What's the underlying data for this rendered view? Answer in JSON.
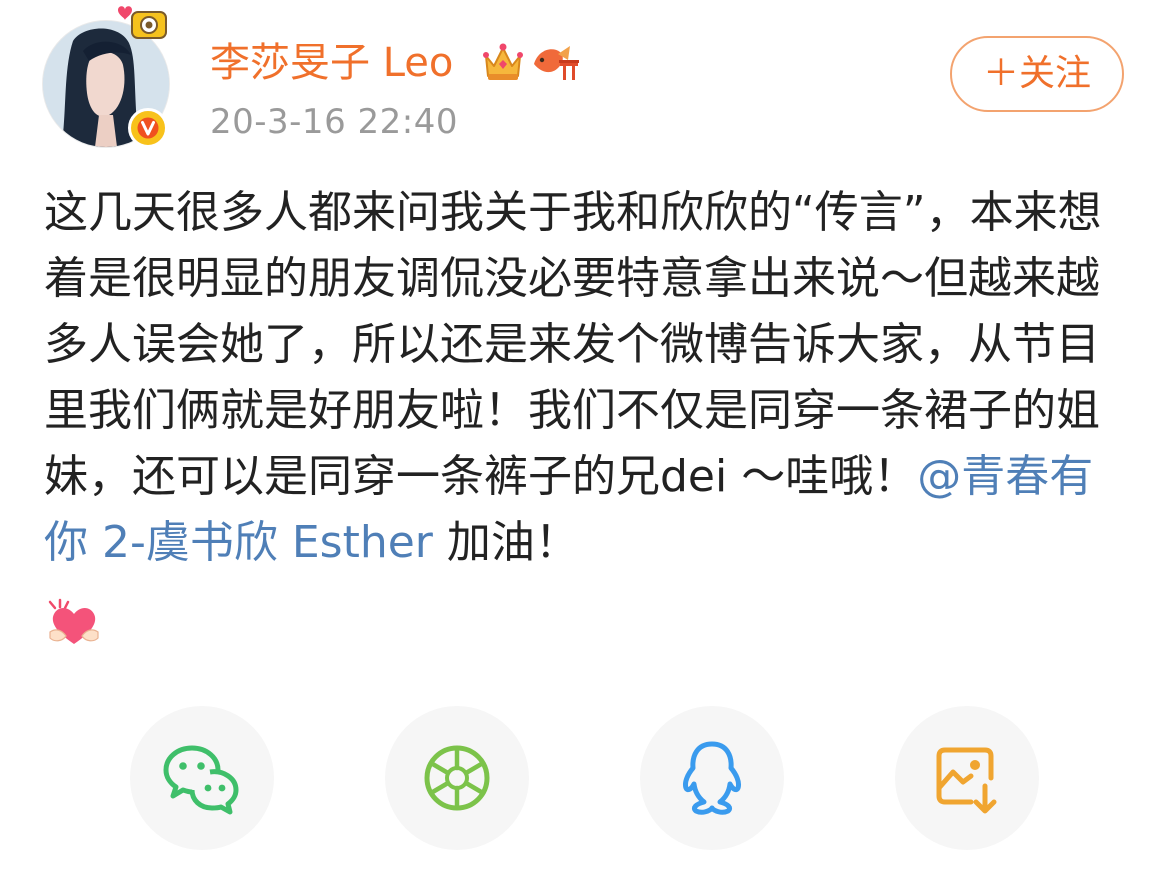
{
  "user": {
    "name": "李莎旻子 Leo",
    "timestamp": "20-3-16 22:40",
    "verified_badge": "V"
  },
  "follow_button": {
    "label": "＋关注"
  },
  "post": {
    "text_before_mention": "这几天很多人都来问我关于我和欣欣的“传言”，本来想着是很明显的朋友调侃没必要特意拿出来说～但越来越多人误会她了，所以还是来发个微博告诉大家，从节目里我们俩就是好朋友啦！我们不仅是同穿一条裙子的姐妹，还可以是同穿一条裤子的兄dei ～哇哦！",
    "mention": "@青春有你 2-虞书欣 Esther",
    "text_after_mention": " 加油！"
  },
  "share_buttons": [
    {
      "icon": "wechat-icon"
    },
    {
      "icon": "moments-icon"
    },
    {
      "icon": "qq-icon"
    },
    {
      "icon": "save-image-icon"
    }
  ],
  "colors": {
    "username": "#f0702b",
    "mention": "#4f7fb7",
    "timestamp": "#9a9a9a",
    "body_text": "#222222",
    "wechat": "#3fbf6a",
    "moments": "#7cc34a",
    "qq": "#3a9bee",
    "save_image": "#f0a530"
  }
}
